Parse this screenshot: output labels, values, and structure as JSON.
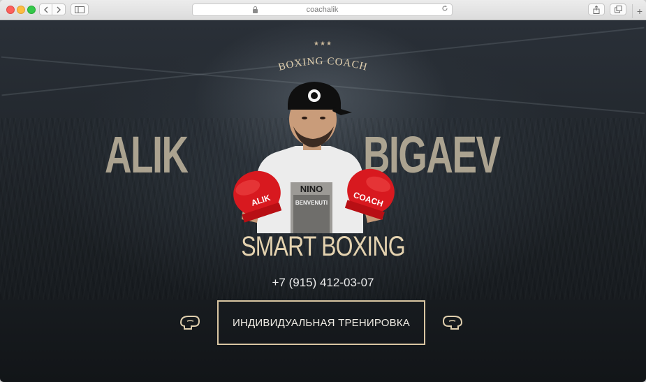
{
  "browser": {
    "url": "coachalik",
    "buttons": {
      "back_icon": "chevron-left-icon",
      "forward_icon": "chevron-right-icon",
      "sidebar_icon": "sidebar-icon",
      "share_icon": "share-icon",
      "tabs_icon": "tabs-icon",
      "new_tab_label": "+"
    }
  },
  "hero": {
    "stars": "★★★",
    "coach_label": "BOXING COACH",
    "first_name": "ALIK",
    "last_name": "BIGAEV",
    "shirt_text_1": "NINO",
    "shirt_text_2": "BENVENUTI",
    "glove_left_text": "ALIK",
    "glove_right_text": "COACH",
    "tagline": "SMART BOXING",
    "phone": "+7 (915) 412-03-07",
    "cta_label": "ИНДИВИДУАЛЬНАЯ ТРЕНИРОВКА"
  },
  "colors": {
    "accent": "#d9c6a2",
    "name_color": "#b7ad98",
    "tagline_color": "#e5d3b0",
    "glove_red": "#d8191f"
  }
}
